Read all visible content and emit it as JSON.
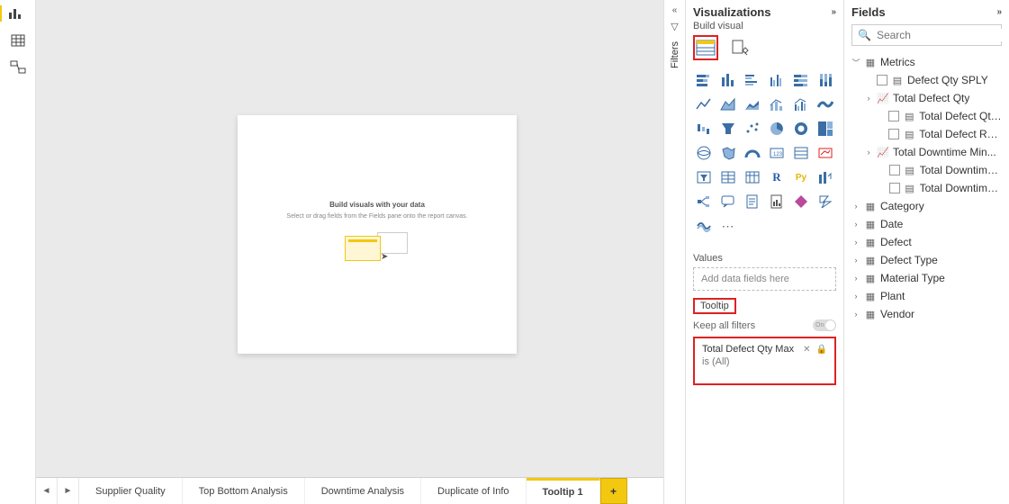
{
  "left_rail": {
    "icons": [
      "report-view",
      "data-view",
      "model-view"
    ]
  },
  "canvas": {
    "title": "Build visuals with your data",
    "subtitle": "Select or drag fields from the Fields pane onto the report canvas."
  },
  "tabs": {
    "items": [
      "Supplier Quality",
      "Top Bottom Analysis",
      "Downtime Analysis",
      "Duplicate of Info",
      "Tooltip 1"
    ],
    "active": 4,
    "add": "+"
  },
  "filters_rail": {
    "label": "Filters"
  },
  "viz": {
    "title": "Visualizations",
    "subtitle": "Build visual",
    "values_label": "Values",
    "values_placeholder": "Add data fields here",
    "tooltip_label": "Tooltip",
    "keep_filters": "Keep all filters",
    "toggle_text": "On",
    "filter_card": {
      "name": "Total Defect Qty Max",
      "condition": "is (All)"
    }
  },
  "fields": {
    "title": "Fields",
    "search_placeholder": "Search",
    "metrics_label": "Metrics",
    "metric_items": [
      {
        "label": "Defect Qty SPLY",
        "icon": "calc",
        "cb": true,
        "exp": null
      },
      {
        "label": "Total Defect Qty",
        "icon": "trend",
        "cb": false,
        "exp": "open"
      },
      {
        "label": "Total Defect Qty ...",
        "icon": "calc",
        "cb": true,
        "exp": null,
        "child": true
      },
      {
        "label": "Total Defect Rep...",
        "icon": "calc",
        "cb": true,
        "exp": null,
        "child": true
      },
      {
        "label": "Total Downtime Min...",
        "icon": "trend",
        "cb": false,
        "exp": "closed"
      },
      {
        "label": "Total Downtime ...",
        "icon": "calc",
        "cb": true,
        "exp": null,
        "child": true
      },
      {
        "label": "Total Downtime ...",
        "icon": "calc",
        "cb": true,
        "exp": null,
        "child": true
      }
    ],
    "tables": [
      "Category",
      "Date",
      "Defect",
      "Defect Type",
      "Material Type",
      "Plant",
      "Vendor"
    ]
  }
}
